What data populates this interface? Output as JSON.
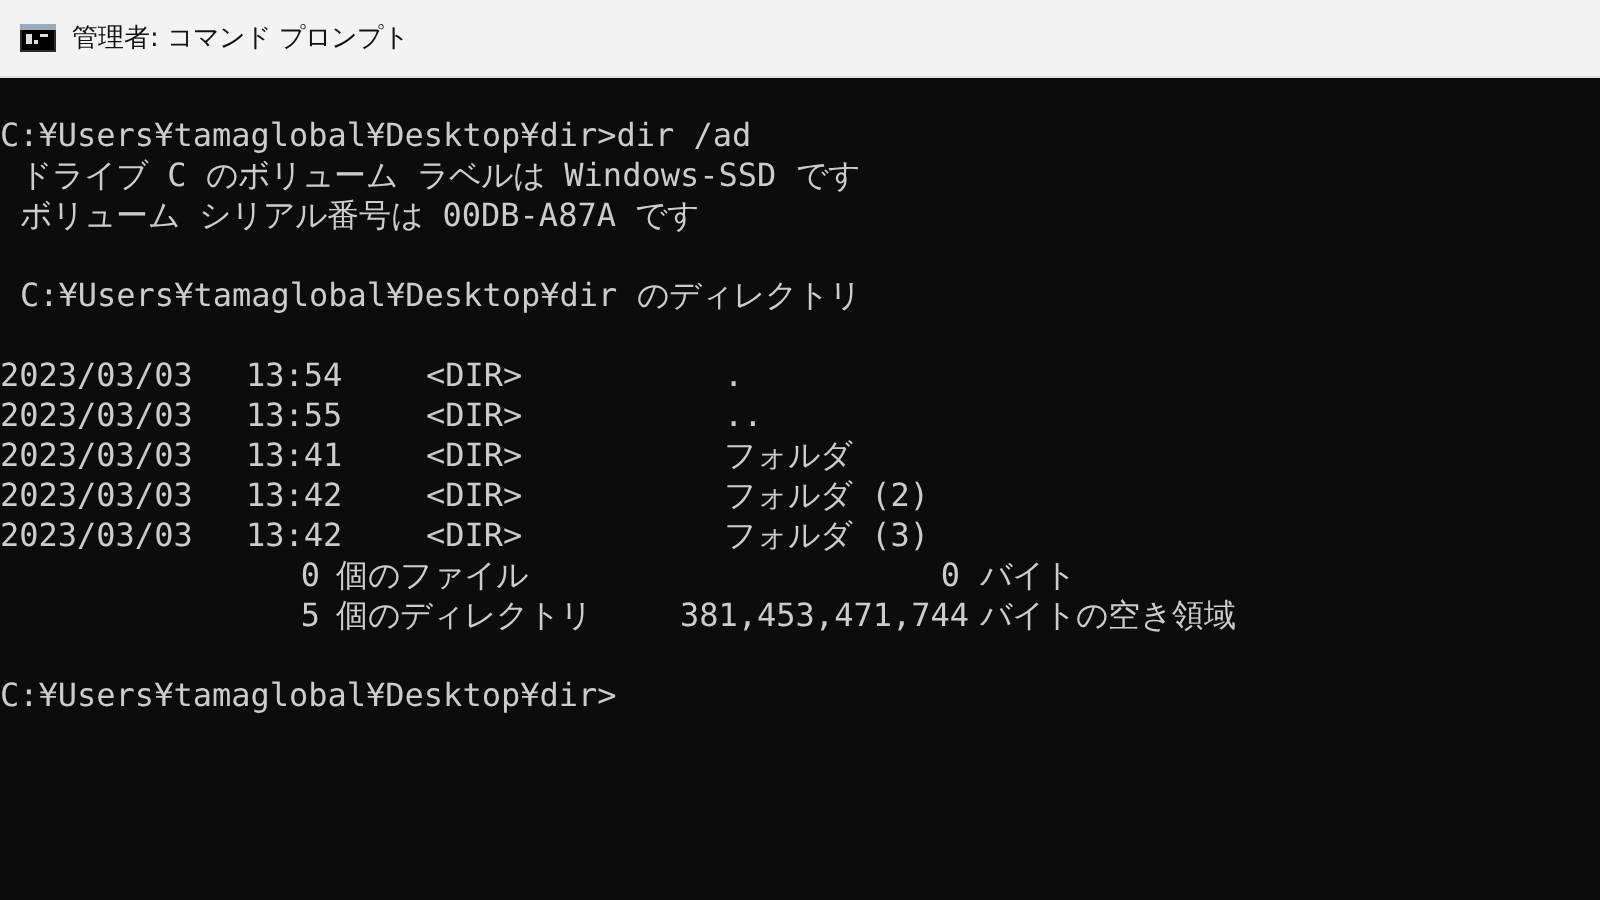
{
  "window": {
    "title": "管理者: コマンド プロンプト"
  },
  "console": {
    "command_line": "C:¥Users¥tamaglobal¥Desktop¥dir>dir /ad",
    "volume_lines": [
      "ドライブ C のボリューム ラベルは Windows-SSD です",
      "ボリューム シリアル番号は 00DB-A87A です"
    ],
    "directory_heading": "C:¥Users¥tamaglobal¥Desktop¥dir のディレクトリ",
    "entries": [
      {
        "date": "2023/03/03",
        "time": "13:54",
        "type": "<DIR>",
        "name": "."
      },
      {
        "date": "2023/03/03",
        "time": "13:55",
        "type": "<DIR>",
        "name": ".."
      },
      {
        "date": "2023/03/03",
        "time": "13:41",
        "type": "<DIR>",
        "name": "フォルダ"
      },
      {
        "date": "2023/03/03",
        "time": "13:42",
        "type": "<DIR>",
        "name": "フォルダ (2)"
      },
      {
        "date": "2023/03/03",
        "time": "13:42",
        "type": "<DIR>",
        "name": "フォルダ (3)"
      }
    ],
    "summary": [
      {
        "count": "0",
        "label": "個のファイル",
        "size": "0",
        "unit": "バイト"
      },
      {
        "count": "5",
        "label": "個のディレクトリ",
        "size": "381,453,471,744",
        "unit": "バイトの空き領域"
      }
    ],
    "prompt": "C:¥Users¥tamaglobal¥Desktop¥dir>"
  }
}
